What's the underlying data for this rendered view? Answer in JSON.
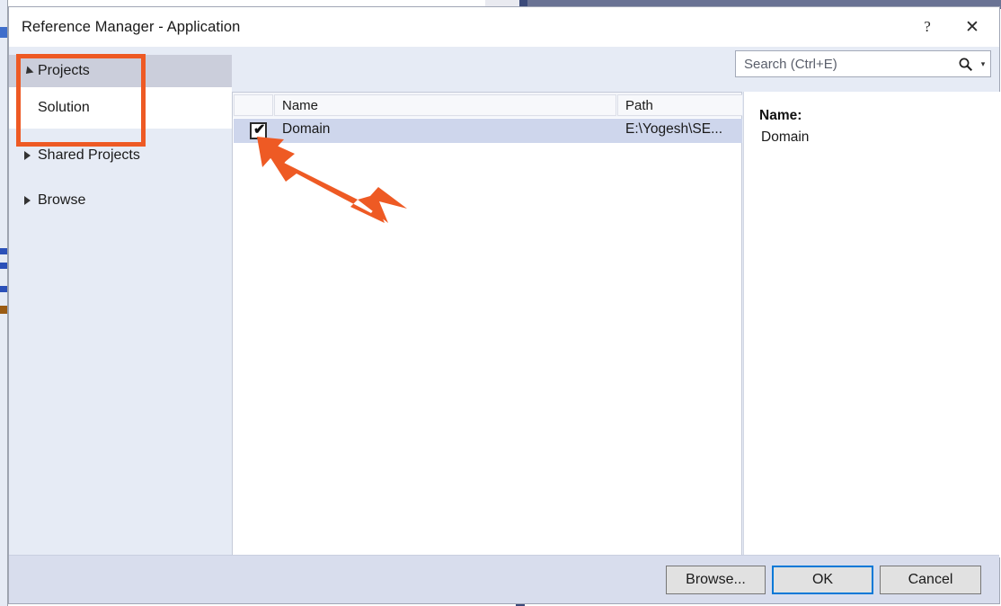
{
  "window": {
    "title": "Reference Manager - Application",
    "help_label": "?",
    "close_label": "✕"
  },
  "sidebar": {
    "items": [
      {
        "label": "Projects",
        "twisty": "expanded",
        "state": "expanded"
      },
      {
        "label": "Solution",
        "twisty": "none",
        "state": "selected"
      },
      {
        "label": "Shared Projects",
        "twisty": "collapsed",
        "state": "normal"
      },
      {
        "label": "Browse",
        "twisty": "collapsed",
        "state": "normal"
      }
    ]
  },
  "search": {
    "placeholder": "Search (Ctrl+E)",
    "value": "",
    "icon": "search-icon",
    "caret": "▾"
  },
  "list": {
    "columns": [
      "",
      "Name",
      "Path"
    ],
    "rows": [
      {
        "checked": true,
        "check_glyph": "✔",
        "name": "Domain",
        "path": "E:\\Yogesh\\SE..."
      }
    ]
  },
  "detail": {
    "label": "Name:",
    "value": "Domain"
  },
  "footer": {
    "browse_label": "Browse...",
    "ok_label": "OK",
    "cancel_label": "Cancel"
  },
  "annotations": {
    "highlight_color": "#ee5a24",
    "arrow_color": "#ee5a24",
    "rect_target": "Projects / Solution tree nodes",
    "arrow_target": "Domain row checkbox"
  }
}
